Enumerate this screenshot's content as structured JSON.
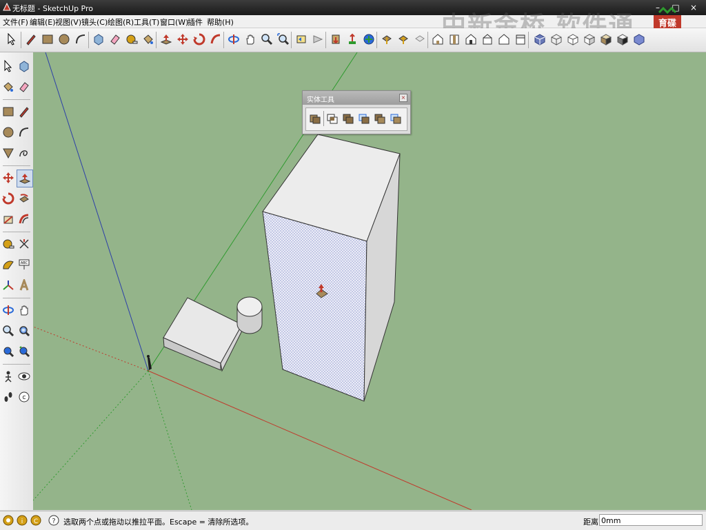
{
  "window": {
    "title": "无标题 - SketchUp Pro",
    "minimize": "–",
    "maximize": "□",
    "close": "×"
  },
  "menu": [
    {
      "label": "文件(F)"
    },
    {
      "label": "编辑(E)"
    },
    {
      "label": "视图(V)"
    },
    {
      "label": "镜头(C)"
    },
    {
      "label": "绘图(R)"
    },
    {
      "label": "工具(T)"
    },
    {
      "label": "窗口(W)"
    },
    {
      "label": "插件"
    },
    {
      "label": "帮助(H)"
    }
  ],
  "watermark": {
    "text": "中新金桥 软件通",
    "logo_text": "育碟软件"
  },
  "toolbar_icons": [
    "select-icon",
    "pencil-icon",
    "rectangle-icon",
    "circle-icon",
    "arc-icon",
    "make-component-icon",
    "eraser-icon",
    "tape-measure-icon",
    "paint-bucket-icon",
    "push-pull-icon",
    "move-icon",
    "rotate-icon",
    "follow-me-icon",
    "orbit-icon",
    "pan-icon",
    "zoom-icon",
    "zoom-extents-icon",
    "previous-view-icon",
    "next-view-icon",
    "get-models-icon",
    "share-model-icon",
    "place-model-icon",
    "share-component-icon",
    "get-photo-texture-icon",
    "preview-icon",
    "iso-view-icon",
    "top-view-icon",
    "front-view-icon",
    "right-view-icon",
    "back-view-icon",
    "left-view-icon",
    "xray-style-icon",
    "wireframe-style-icon",
    "hidden-line-style-icon",
    "shaded-style-icon",
    "shaded-textures-style-icon",
    "monochrome-style-icon"
  ],
  "left_toolbar_icons": [
    "select-icon",
    "make-component-icon",
    "paint-bucket-icon",
    "eraser-icon",
    "rectangle-icon",
    "line-icon",
    "circle-icon",
    "arc-icon",
    "polygon-icon",
    "freehand-icon",
    "move-icon",
    "push-pull-icon",
    "rotate-icon",
    "follow-me-icon",
    "scale-icon",
    "offset-icon",
    "tape-measure-icon",
    "dimension-icon",
    "protractor-icon",
    "text-icon",
    "axes-icon",
    "3d-text-icon",
    "orbit-icon",
    "pan-icon",
    "zoom-icon",
    "zoom-window-icon",
    "zoom-extents-icon",
    "previous-icon",
    "position-camera-icon",
    "look-around-icon",
    "walk-icon",
    "section-plane-icon"
  ],
  "solid_tools": {
    "title": "实体工具",
    "close": "×",
    "icons": [
      "outer-shell-icon",
      "intersect-icon",
      "union-icon",
      "subtract-icon",
      "trim-icon",
      "split-icon"
    ]
  },
  "status": {
    "text": "选取两个点或拖动以推拉平面。Escape = 清除所选项。",
    "vcb_label": "距离",
    "vcb_value": "0mm"
  },
  "colors": {
    "viewport_background": "#94b48a",
    "axis_red": "#c0392b",
    "axis_green": "#2e9a2e",
    "axis_blue": "#2c3fa8"
  }
}
